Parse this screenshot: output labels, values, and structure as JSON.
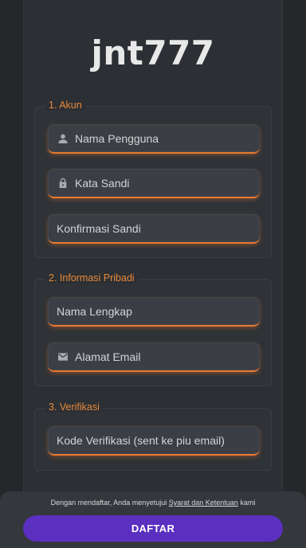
{
  "logo": "jnt777",
  "sections": [
    {
      "legend": "1. Akun",
      "fields": [
        {
          "placeholder": "Nama Pengguna",
          "icon": "user-icon"
        },
        {
          "placeholder": "Kata Sandi",
          "icon": "lock-icon"
        },
        {
          "placeholder": "Konfirmasi Sandi",
          "icon": ""
        }
      ]
    },
    {
      "legend": "2. Informasi Pribadi",
      "fields": [
        {
          "placeholder": "Nama Lengkap",
          "icon": ""
        },
        {
          "placeholder": "Alamat Email",
          "icon": "email-icon"
        }
      ]
    },
    {
      "legend": "3. Verifikasi",
      "fields": [
        {
          "placeholder": "Kode Verifikasi (sent ke piu email)",
          "icon": ""
        }
      ]
    }
  ],
  "footer": {
    "terms_prefix": "Dengan mendaftar, Anda menyetujui",
    "terms_link": "Syarat dan Ketentuan",
    "terms_suffix": "kami",
    "button_label": "DAFTAR"
  },
  "colors": {
    "accent": "#e8792e",
    "button": "#5b2fc0",
    "background": "#25272b"
  }
}
